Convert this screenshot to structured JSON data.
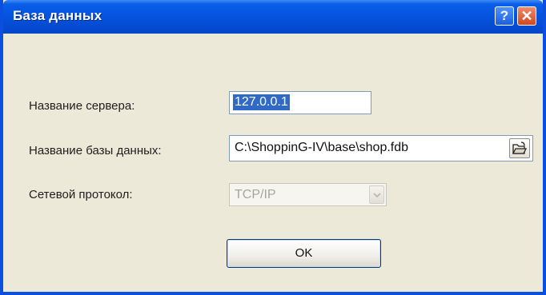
{
  "window": {
    "title": "База данных",
    "help_label": "?",
    "close_label": "✕"
  },
  "form": {
    "server_label": "Название сервера:",
    "server_value": "127.0.0.1",
    "db_label": "Название базы данных:",
    "db_value": "C:\\ShoppinG-IV\\base\\shop.fdb",
    "protocol_label": "Сетевой протокол:",
    "protocol_value": "TCP/IP",
    "ok_label": "OK"
  },
  "icons": {
    "browse": "open-folder-icon",
    "dropdown": "chevron-down-icon"
  },
  "colors": {
    "titlebar": "#0550da",
    "selection": "#316ac5",
    "dialog_bg": "#ece9d8"
  }
}
